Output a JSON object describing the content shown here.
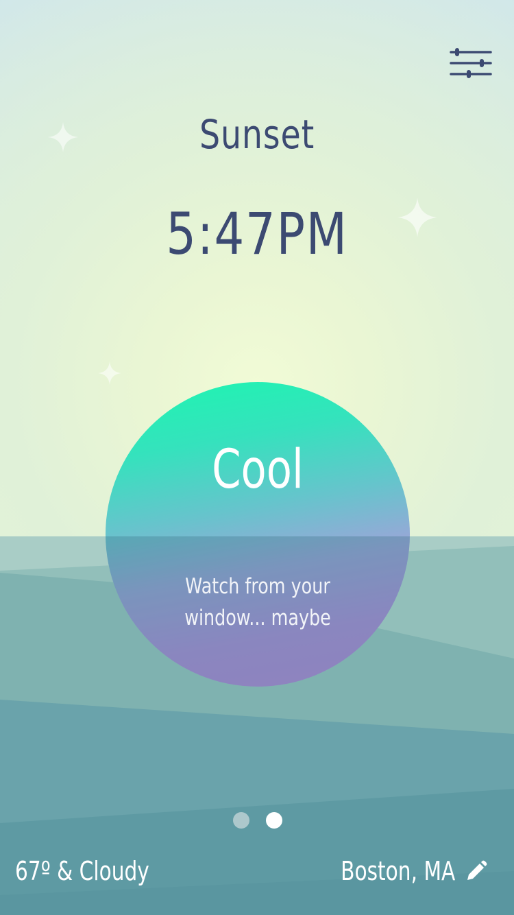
{
  "header": {
    "title": "Sunset",
    "time": "5:47PM",
    "settings_icon": "sliders-icon"
  },
  "rating": {
    "label": "Cool",
    "description": "Watch from your window... maybe"
  },
  "pager": {
    "total": 2,
    "active": 2
  },
  "footer": {
    "weather": "67º & Cloudy",
    "location": "Boston, MA",
    "edit_icon": "pencil-icon"
  },
  "colors": {
    "text_dark": "#3c4a72",
    "orb_top": "#1df6b0",
    "orb_bottom": "#b98ddc",
    "sea": "#6aa3ab"
  }
}
